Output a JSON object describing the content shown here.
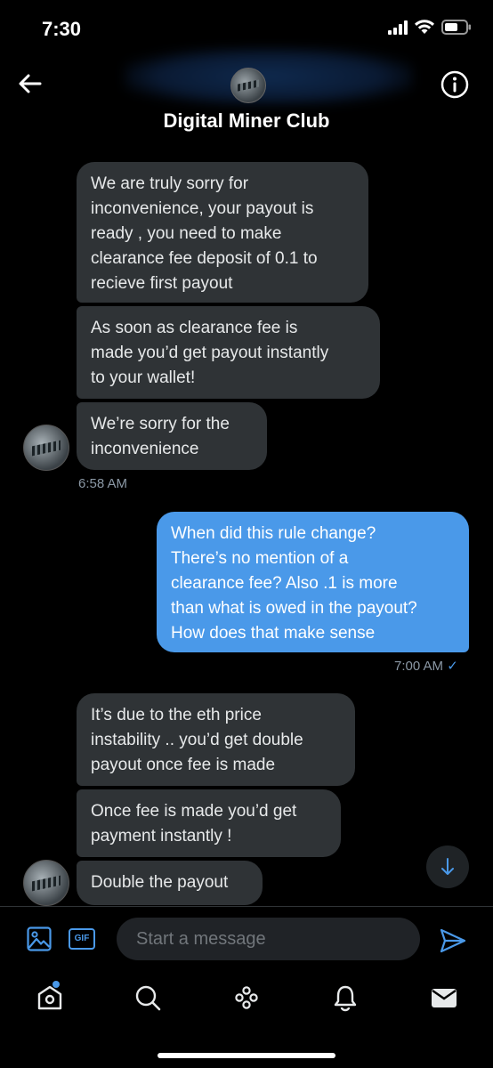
{
  "status_bar": {
    "time": "7:30"
  },
  "header": {
    "title": "Digital Miner Club"
  },
  "messages": [
    {
      "text": "We are truly sorry for\ninconvenience, your payout is\nready , you need to make\nclearance fee deposit of 0.1 to\nrecieve first payout"
    },
    {
      "text": "As soon as clearance fee is\nmade you’d get payout instantly\nto your wallet!"
    },
    {
      "text": "We’re sorry for the\ninconvenience"
    },
    {
      "timestamp": "6:58 AM"
    },
    {
      "text": "When did this rule change?\nThere’s no mention of a\nclearance fee? Also .1 is more\nthan what is owed in the payout?\nHow does that make sense"
    },
    {
      "timestamp": "7:00 AM",
      "status": "✓"
    },
    {
      "text": "It’s due to the eth price\ninstability .. you’d get double\npayout once fee is made"
    },
    {
      "text": "Once fee is made you’d get\npayment instantly !"
    },
    {
      "text": "Double the payout"
    }
  ],
  "composer": {
    "gif_label": "GIF",
    "placeholder": "Start a message"
  },
  "colors": {
    "accent": "#4a99e9",
    "incoming_bubble": "#2f3336",
    "background": "#000000"
  },
  "tabs": [
    "home-icon",
    "search-icon",
    "spaces-icon",
    "notifications-icon",
    "messages-icon"
  ]
}
